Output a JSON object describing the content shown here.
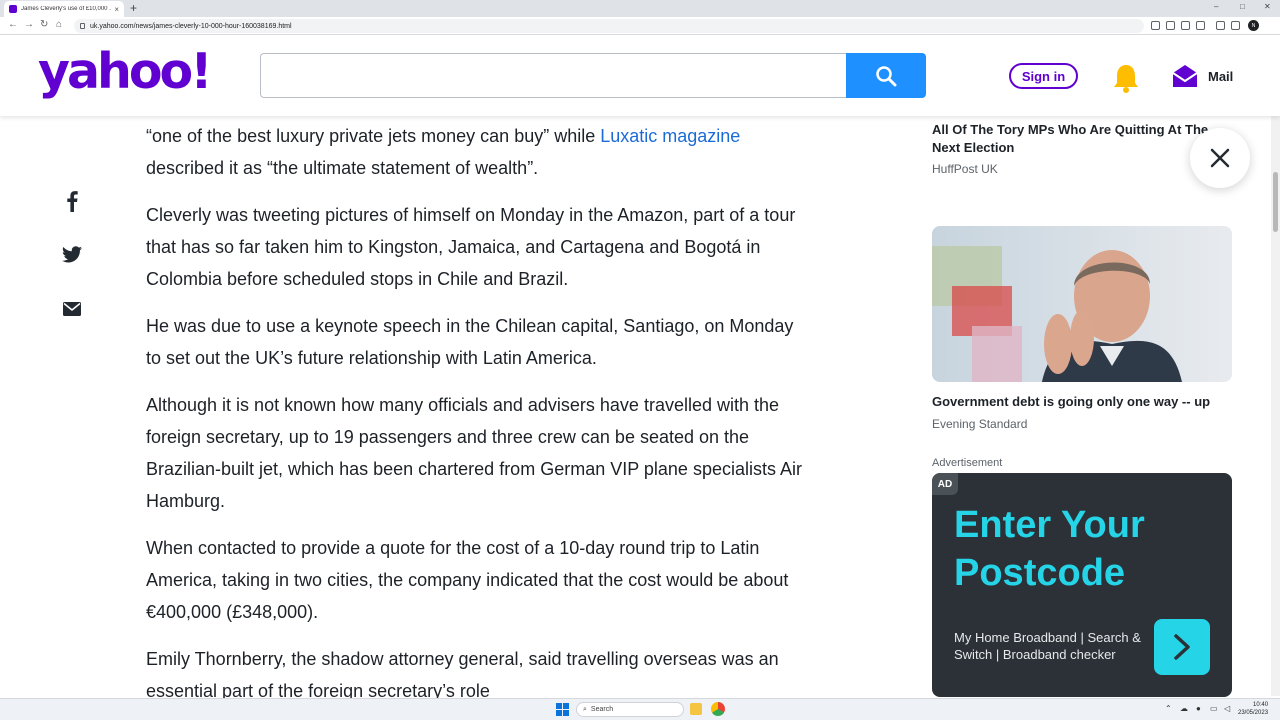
{
  "browser": {
    "tab_title": "James Cleverly's use of £10,000 ...",
    "tab_close": "×",
    "new_tab": "+",
    "url": "uk.yahoo.com/news/james-cleverly-10-000-hour-160038169.html",
    "profile_initials": "N",
    "window_controls": [
      "–",
      "□",
      "✕"
    ],
    "nav": [
      "←",
      "→",
      "↻",
      "⌂"
    ]
  },
  "header": {
    "logo": "yahoo!",
    "search": {
      "value": "",
      "placeholder": ""
    },
    "sign_in": "Sign in",
    "mail": "Mail",
    "brand_color": "#6001d2",
    "search_button_color": "#1e90ff"
  },
  "share": {
    "icons": [
      "facebook-icon",
      "twitter-icon",
      "email-icon"
    ]
  },
  "article": {
    "lead_text": "“one of the best luxury private jets money can buy” while ",
    "lead_link": "Luxatic magazine",
    "lead_text_end": " described it as “the ultimate statement of wealth”.",
    "paragraphs": [
      "Cleverly was tweeting pictures of himself on Monday in the Amazon, part of a tour that has so far taken him to Kingston, Jamaica, and Cartagena and Bogotá in Colombia before scheduled stops in Chile and Brazil.",
      "He was due to use a keynote speech in the Chilean capital, Santiago, on Monday to set out the UK’s future relationship with Latin America.",
      "Although it is not known how many officials and advisers have travelled with the foreign secretary, up to 19 passengers and three crew can be seated on the Brazilian-built jet, which has been chartered from German VIP plane specialists Air Hamburg.",
      "When contacted to provide a quote for the cost of a 10-day round trip to Latin America, taking in two cities, the company indicated that the cost would be about €400,000 (£348,000).",
      "Emily Thornberry, the shadow attorney general, said travelling overseas was an essential part of the foreign secretary’s role"
    ]
  },
  "sidebar": {
    "story1": {
      "title": "All Of The Tory MPs Who Are Quitting At The Next Election",
      "source": "HuffPost UK"
    },
    "story2": {
      "title": "Government debt is going only one way -- up",
      "source": "Evening Standard"
    },
    "ad": {
      "label": "Advertisement",
      "badge": "AD",
      "headline_line1": "Enter Your",
      "headline_line2": "Postcode",
      "subtext": "My Home Broadband | Search & Switch | Broadband checker",
      "accent": "#26d4e8"
    }
  },
  "taskbar": {
    "search": "Search",
    "time": "10:40",
    "date": "23/05/2023"
  }
}
